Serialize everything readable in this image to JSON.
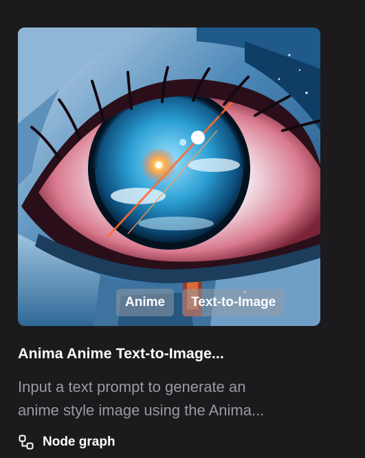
{
  "card": {
    "image_alt": "Anime-style illustration of a mechanical eye reflecting a sky",
    "tags": [
      "Anime",
      "Text-to-Image"
    ],
    "title": "Anima Anime Text-to-Image...",
    "description_lines": [
      "Input a text prompt to generate an",
      "anime style image using the Anima..."
    ],
    "type_icon": "node-graph-icon",
    "type_label": "Node graph"
  },
  "colors": {
    "background": "#1c1a1d",
    "title_text": "#ffffff",
    "description_text": "#9c9aa0",
    "tag_background": "rgba(150,155,165,0.52)"
  }
}
